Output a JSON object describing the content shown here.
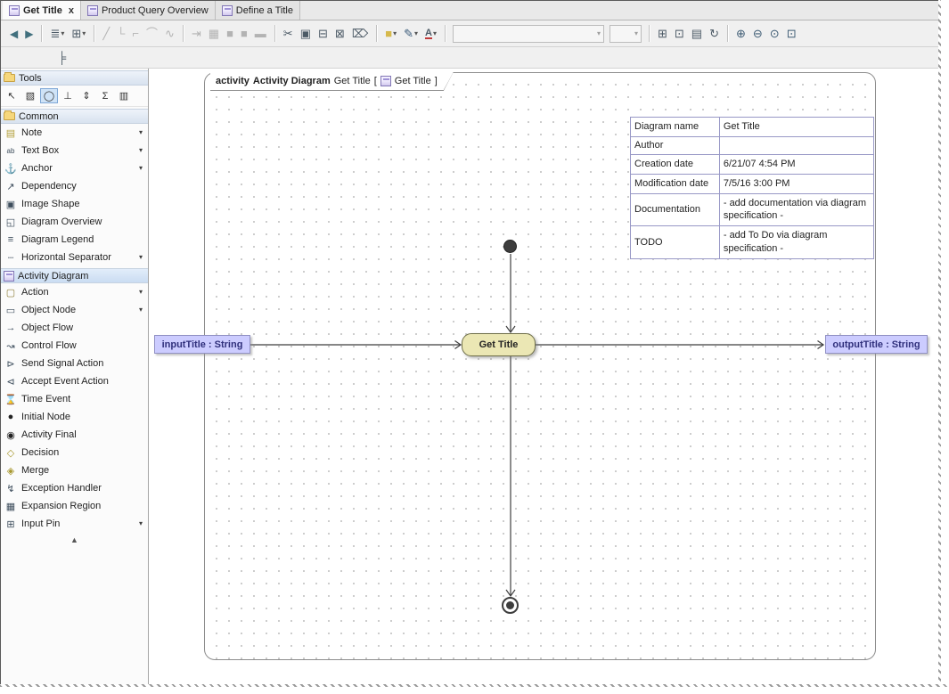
{
  "tabs": [
    {
      "label": "Get Title",
      "icon": "activity-diagram-icon",
      "active": true,
      "closable": true,
      "close_glyph": "x"
    },
    {
      "label": "Product Query Overview",
      "icon": "activity-diagram-icon",
      "active": false
    },
    {
      "label": "Define a Title",
      "icon": "activity-diagram-icon",
      "active": false
    }
  ],
  "toolbar": {
    "groups": [
      {
        "buttons": [
          {
            "name": "back-button",
            "icon": "back-icon"
          },
          {
            "name": "forward-button",
            "icon": "forward-icon"
          }
        ]
      },
      {
        "buttons": [
          {
            "name": "layout-button",
            "icon": "layout-icon",
            "dropdown": true
          },
          {
            "name": "related-elements-button",
            "icon": "related-elements-icon",
            "dropdown": true
          }
        ]
      },
      {
        "buttons": [
          {
            "name": "oblique-path-button",
            "icon": "oblique-line-icon",
            "disabled": true
          },
          {
            "name": "rectilinear-path-button",
            "icon": "rectilinear-line-icon",
            "disabled": true
          },
          {
            "name": "corner-path-button",
            "icon": "corner-line-icon",
            "disabled": true
          },
          {
            "name": "curve-path-button",
            "icon": "curve-line-icon",
            "disabled": true
          },
          {
            "name": "spline-path-button",
            "icon": "spline-line-icon",
            "disabled": true
          }
        ]
      },
      {
        "buttons": [
          {
            "name": "show-parents-button",
            "icon": "show-parents-icon",
            "disabled": true
          },
          {
            "name": "compartments-button",
            "icon": "compartments-icon",
            "disabled": true
          },
          {
            "name": "align-left-button",
            "icon": "align-left-icon",
            "disabled": true
          },
          {
            "name": "align-center-button",
            "icon": "align-center-icon",
            "disabled": true
          },
          {
            "name": "align-bottom-button",
            "icon": "align-bottom-icon",
            "disabled": true
          }
        ]
      },
      {
        "buttons": [
          {
            "name": "cut-button",
            "icon": "cut-icon"
          },
          {
            "name": "copy-button",
            "icon": "copy-icon"
          },
          {
            "name": "paste-button",
            "icon": "paste-icon"
          },
          {
            "name": "delete-button",
            "icon": "delete-icon"
          },
          {
            "name": "delete-from-model-button",
            "icon": "delete-from-model-icon"
          }
        ]
      },
      {
        "buttons": [
          {
            "name": "fill-color-button",
            "icon": "fill-color-icon",
            "dropdown": true
          },
          {
            "name": "line-color-button",
            "icon": "pen-icon",
            "dropdown": true
          },
          {
            "name": "font-color-button",
            "icon": "font-color-icon",
            "dropdown": true
          }
        ]
      },
      {
        "buttons": [
          {
            "name": "style-combo",
            "combo": true,
            "value": "",
            "width": 170,
            "disabled": true
          },
          {
            "name": "zoom-combo",
            "combo": true,
            "value": "",
            "width": 36,
            "disabled": true
          }
        ]
      },
      {
        "buttons": [
          {
            "name": "add-diagram-shape-button",
            "icon": "add-shape-icon"
          },
          {
            "name": "add-diagram-note-button",
            "icon": "add-note-icon"
          },
          {
            "name": "edit-compartment-button",
            "icon": "edit-compartment-icon"
          },
          {
            "name": "refresh-button",
            "icon": "refresh-icon"
          }
        ]
      },
      {
        "buttons": [
          {
            "name": "zoom-in-button",
            "icon": "zoom-in-icon"
          },
          {
            "name": "zoom-out-button",
            "icon": "zoom-out-icon"
          },
          {
            "name": "zoom-1to1-button",
            "icon": "zoom-1to1-icon"
          },
          {
            "name": "fit-in-window-button",
            "icon": "zoom-fit-icon"
          }
        ]
      }
    ]
  },
  "secondary_toolbar": {
    "buttons": [
      {
        "name": "selection-filter-button",
        "icon": "structure-icon"
      }
    ]
  },
  "sidebar": {
    "tools_header": "Tools",
    "common_header": "Common",
    "activity_header": "Activity Diagram",
    "tools": [
      {
        "name": "select-tool",
        "icon": "cursor-icon"
      },
      {
        "name": "marquee-tool",
        "icon": "marquee-icon"
      },
      {
        "name": "shape-creation-tool",
        "icon": "oval-icon",
        "active": true
      },
      {
        "name": "align-tool",
        "icon": "align-tool-icon"
      },
      {
        "name": "distribute-tool",
        "icon": "distribute-icon"
      },
      {
        "name": "resize-tool",
        "icon": "sum-icon"
      },
      {
        "name": "swimlane-tool",
        "icon": "swimlane-icon"
      }
    ],
    "common_items": [
      {
        "label": "Note",
        "icon": "note-icon",
        "dropdown": true
      },
      {
        "label": "Text Box",
        "icon": "text-box-icon",
        "dropdown": true
      },
      {
        "label": "Anchor",
        "icon": "anchor-icon",
        "dropdown": true
      },
      {
        "label": "Dependency",
        "icon": "dependency-icon"
      },
      {
        "label": "Image Shape",
        "icon": "image-shape-icon"
      },
      {
        "label": "Diagram Overview",
        "icon": "diagram-overview-icon"
      },
      {
        "label": "Diagram Legend",
        "icon": "diagram-legend-icon"
      },
      {
        "label": "Horizontal Separator",
        "icon": "horizontal-separator-icon",
        "dropdown": true
      }
    ],
    "activity_items": [
      {
        "label": "Action",
        "icon": "action-icon",
        "dropdown": true
      },
      {
        "label": "Object Node",
        "icon": "object-node-icon",
        "dropdown": true
      },
      {
        "label": "Object Flow",
        "icon": "object-flow-icon"
      },
      {
        "label": "Control Flow",
        "icon": "control-flow-icon"
      },
      {
        "label": "Send Signal Action",
        "icon": "send-signal-icon"
      },
      {
        "label": "Accept Event Action",
        "icon": "accept-event-icon"
      },
      {
        "label": "Time Event",
        "icon": "time-event-icon"
      },
      {
        "label": "Initial Node",
        "icon": "initial-node-icon"
      },
      {
        "label": "Activity Final",
        "icon": "activity-final-icon"
      },
      {
        "label": "Decision",
        "icon": "decision-icon"
      },
      {
        "label": "Merge",
        "icon": "merge-icon"
      },
      {
        "label": "Exception Handler",
        "icon": "exception-handler-icon"
      },
      {
        "label": "Expansion Region",
        "icon": "expansion-region-icon"
      },
      {
        "label": "Input Pin",
        "icon": "input-pin-icon",
        "dropdown": true
      }
    ]
  },
  "canvas": {
    "frame": {
      "keyword": "activity",
      "type": "Activity Diagram",
      "name": "Get Title",
      "bracket_open": "[",
      "ref": "Get Title",
      "bracket_close": "]"
    },
    "info_table": {
      "rows": [
        {
          "label": "Diagram name",
          "value": "Get Title"
        },
        {
          "label": "Author",
          "value": ""
        },
        {
          "label": "Creation date",
          "value": "6/21/07 4:54 PM"
        },
        {
          "label": "Modification date",
          "value": "7/5/16 3:00 PM"
        },
        {
          "label": "Documentation",
          "value": "- add documentation via diagram specification -"
        },
        {
          "label": "TODO",
          "value": "- add To Do via diagram specification -"
        }
      ]
    },
    "action": {
      "label": "Get Title"
    },
    "input_param": {
      "label": "inputTitle : String"
    },
    "output_param": {
      "label": "outputTitle : String"
    }
  },
  "colors": {
    "action_fill": "#ebe7b4",
    "action_border": "#6f6f49",
    "param_fill": "#ccccff",
    "param_border": "#9191c4",
    "param_text": "#30307c",
    "table_border": "#9898c6",
    "flow": "#3f3f3f",
    "selection": "#cfe3f7"
  }
}
